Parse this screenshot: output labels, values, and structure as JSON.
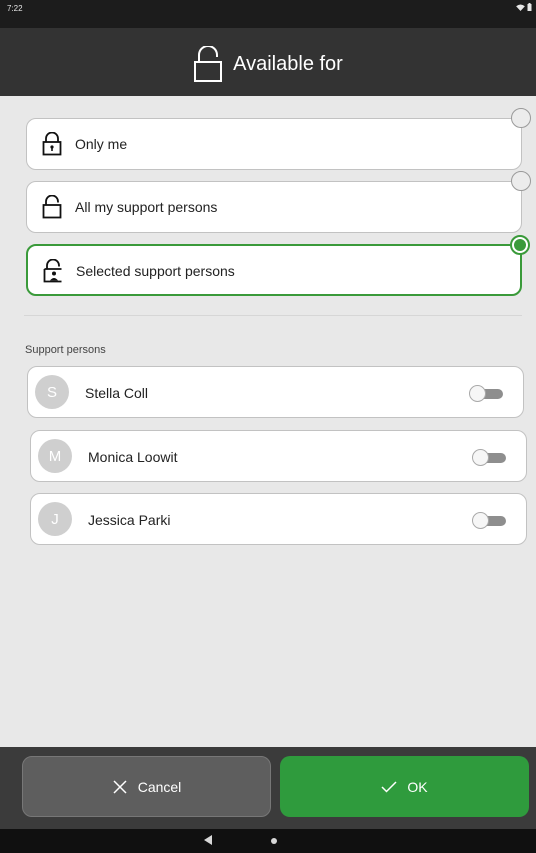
{
  "status": {
    "time": "7:22"
  },
  "header": {
    "title": "Available for",
    "icon": "unlock-icon"
  },
  "options": [
    {
      "label": "Only me",
      "icon": "lock-icon",
      "selected": false
    },
    {
      "label": "All my support persons",
      "icon": "unlock-icon",
      "selected": false
    },
    {
      "label": "Selected support persons",
      "icon": "person-lock-icon",
      "selected": true
    }
  ],
  "support": {
    "section_label": "Support persons",
    "persons": [
      {
        "initial": "S",
        "name": "Stella Coll",
        "enabled": false
      },
      {
        "initial": "M",
        "name": "Monica Loowit",
        "enabled": false
      },
      {
        "initial": "J",
        "name": "Jessica Parki",
        "enabled": false
      }
    ]
  },
  "footer": {
    "cancel_label": "Cancel",
    "ok_label": "OK"
  },
  "colors": {
    "accent": "#2f9b3d",
    "header": "#333333",
    "background": "#e8e8e8"
  }
}
